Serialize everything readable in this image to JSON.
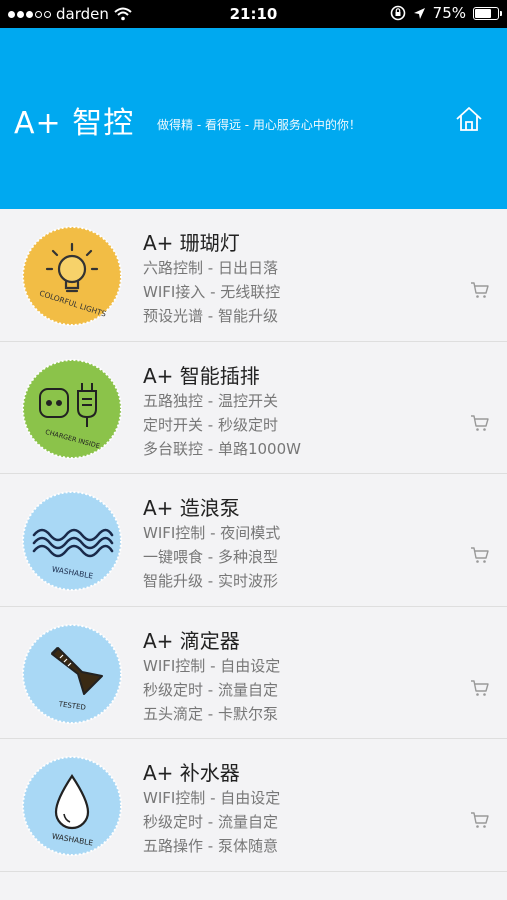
{
  "status_bar": {
    "carrier": "darden",
    "time": "21:10",
    "battery": "75%",
    "battery_level": 0.75
  },
  "header": {
    "title": "A+ 智控",
    "slogan": "做得精 - 看得远 - 用心服务心中的你！",
    "home_icon": "home-icon",
    "background_color": "#00a9f0"
  },
  "products": [
    {
      "name": "A+ 珊瑚灯",
      "lines": [
        "六路控制 - 日出日落",
        "WIFI接入 - 无线联控",
        "预设光谱 - 智能升级"
      ],
      "badge_label": "COLORFUL LIGHTS",
      "badge_icon": "light-bulb-icon",
      "badge_color": "#f2bd45"
    },
    {
      "name": "A+ 智能插排",
      "lines": [
        "五路独控 - 温控开关",
        "定时开关 - 秒级定时",
        "多台联控 - 单路1000W"
      ],
      "badge_label": "CHARGER INSIDE",
      "badge_icon": "power-plug-icon",
      "badge_color": "#8bc34a"
    },
    {
      "name": "A+ 造浪泵",
      "lines": [
        "WIFI控制 - 夜间模式",
        "一键喂食 - 多种浪型",
        "智能升级 - 实时波形"
      ],
      "badge_label": "WASHABLE",
      "badge_icon": "waves-icon",
      "badge_color": "#a9d8f5"
    },
    {
      "name": "A+ 滴定器",
      "lines": [
        "WIFI控制 - 自由设定",
        "秒级定时 - 流量自定",
        "五头滴定 - 卡默尔泵"
      ],
      "badge_label": "TESTED",
      "badge_icon": "flask-icon",
      "badge_color": "#a9d8f5"
    },
    {
      "name": "A+ 补水器",
      "lines": [
        "WIFI控制 - 自由设定",
        "秒级定时 - 流量自定",
        "五路操作 - 泵体随意"
      ],
      "badge_label": "WASHABLE",
      "badge_icon": "water-drop-icon",
      "badge_color": "#a9d8f5"
    }
  ],
  "cart_icon": "shopping-cart-icon"
}
